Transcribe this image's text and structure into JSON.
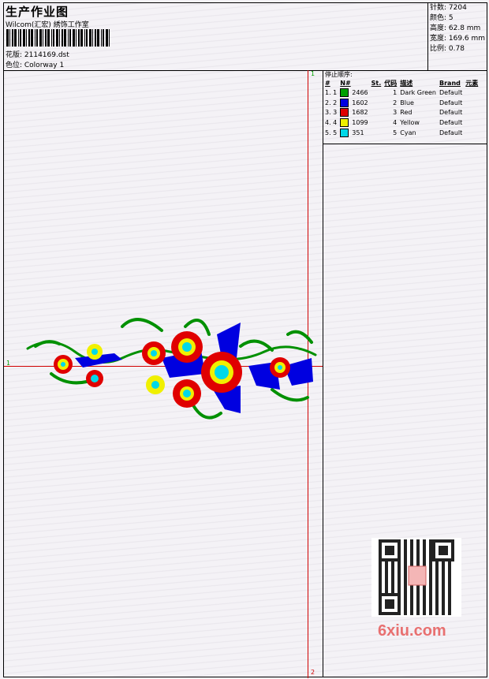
{
  "header": {
    "title": "生产作业图",
    "studio": "Wilcom(汇宏) 綉饰工作室",
    "design_label": "花版: 2114169.dst",
    "colorway_label": "色位: Colorway 1"
  },
  "stats": {
    "stitches": "针数: 7204",
    "colors": "颜色: 5",
    "height": "高度: 62.8 mm",
    "width": "宽度: 169.6 mm",
    "scale": "比例: 0.78"
  },
  "sequence": {
    "title": "停止顺序:",
    "headers": [
      "#",
      "N#",
      "St.",
      "代码",
      "描述",
      "Brand",
      "元素"
    ],
    "rows": [
      {
        "idx": "1. 1",
        "color": "#00a000",
        "st": "2466",
        "code": "1",
        "desc": "Dark Green",
        "brand": "Default"
      },
      {
        "idx": "2. 2",
        "color": "#0000e0",
        "st": "1602",
        "code": "2",
        "desc": "Blue",
        "brand": "Default"
      },
      {
        "idx": "3. 3",
        "color": "#e00000",
        "st": "1682",
        "code": "3",
        "desc": "Red",
        "brand": "Default"
      },
      {
        "idx": "4. 4",
        "color": "#f0f000",
        "st": "1099",
        "code": "4",
        "desc": "Yellow",
        "brand": "Default"
      },
      {
        "idx": "5. 5",
        "color": "#00d8e8",
        "st": "351",
        "code": "5",
        "desc": "Cyan",
        "brand": "Default"
      }
    ]
  },
  "markers": {
    "top": "1",
    "bottom": "2",
    "left": "1"
  },
  "watermark": "6xiu.com"
}
